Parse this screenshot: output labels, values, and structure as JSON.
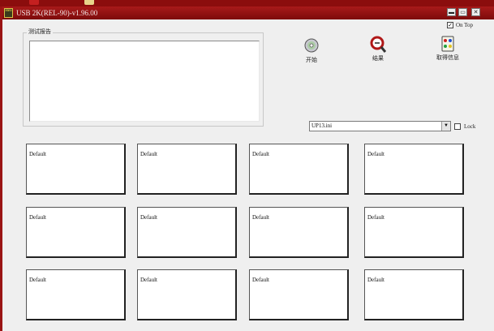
{
  "window": {
    "title": "USB 2K(REL-90)-v1.96.00",
    "app_icon_text": "Hex",
    "minimize_glyph": "▬",
    "restore_glyph": "▭",
    "close_glyph": "✕"
  },
  "report": {
    "group_label": "测试报告",
    "content": ""
  },
  "toolbar": {
    "start_label": "开始",
    "end_label": "结果",
    "info_label": "取得信息"
  },
  "on_top": {
    "label": "On Top",
    "checked_glyph": "✓"
  },
  "config": {
    "selected": "UP13.ini",
    "arrow": "▼"
  },
  "lock": {
    "label": "Lock"
  },
  "panels": [
    "Default",
    "Default",
    "Default",
    "Default",
    "Default",
    "Default",
    "Default",
    "Default",
    "Default",
    "Default",
    "Default",
    "Default"
  ],
  "colors": {
    "title_bar": "#8f1212",
    "desktop": "#7a1010",
    "window_bg": "#efefef"
  }
}
